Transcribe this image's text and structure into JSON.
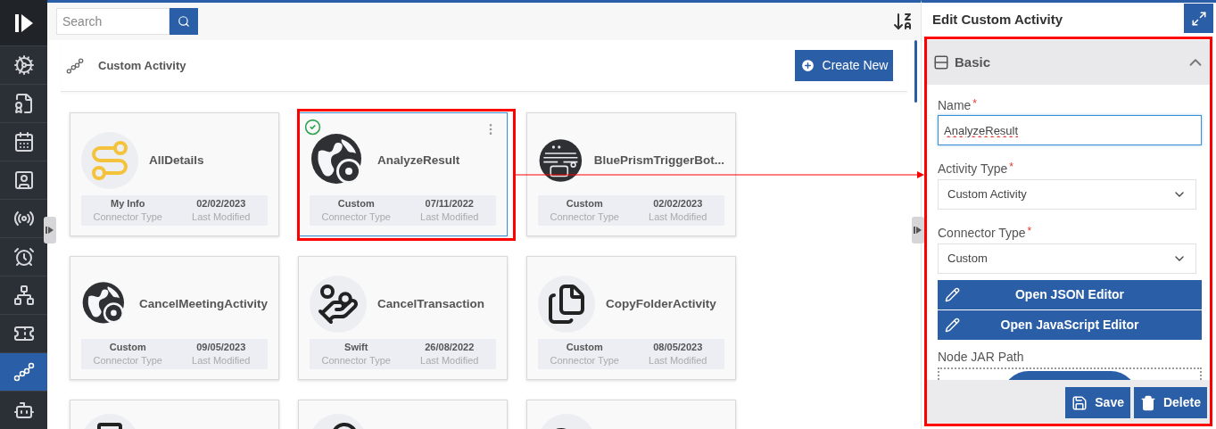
{
  "sidebar": {
    "items": [
      {
        "selected": false
      },
      {
        "selected": false
      },
      {
        "selected": false
      },
      {
        "selected": false
      },
      {
        "selected": false
      },
      {
        "selected": false
      },
      {
        "selected": false
      },
      {
        "selected": false
      },
      {
        "selected": true
      },
      {
        "selected": false
      }
    ]
  },
  "search": {
    "placeholder": "Search"
  },
  "page_title": "Custom Activity",
  "create_button": "Create New",
  "cards": [
    {
      "kind": "full",
      "name": "AllDetails",
      "connector": "My Info",
      "connector_label": "Connector Type",
      "date": "02/02/2023",
      "date_label": "Last Modified",
      "selected": false
    },
    {
      "kind": "full",
      "name": "AnalyzeResult",
      "connector": "Custom",
      "connector_label": "Connector Type",
      "date": "07/11/2022",
      "date_label": "Last Modified",
      "selected": true
    },
    {
      "kind": "full",
      "name": "BluePrismTriggerBot...",
      "connector": "Custom",
      "connector_label": "Connector Type",
      "date": "02/02/2023",
      "date_label": "Last Modified",
      "selected": false
    },
    {
      "kind": "full",
      "name": "CancelMeetingActivity",
      "connector": "Custom",
      "connector_label": "Connector Type",
      "date": "09/05/2023",
      "date_label": "Last Modified",
      "selected": false
    },
    {
      "kind": "full",
      "name": "CancelTransaction",
      "connector": "Swift",
      "connector_label": "Connector Type",
      "date": "26/08/2022",
      "date_label": "Last Modified",
      "selected": false
    },
    {
      "kind": "full",
      "name": "CopyFolderActivity",
      "connector": "Custom",
      "connector_label": "Connector Type",
      "date": "08/05/2023",
      "date_label": "Last Modified",
      "selected": false
    },
    {
      "kind": "cut",
      "selected": false
    },
    {
      "kind": "cut",
      "selected": false
    },
    {
      "kind": "cut",
      "selected": false
    }
  ],
  "editor": {
    "title": "Edit Custom Activity",
    "section": {
      "title": "Basic",
      "expanded": true
    },
    "fields": [
      {
        "kind": "input",
        "label": "Name",
        "required_mark": "*",
        "value": "AnalyzeResult"
      },
      {
        "kind": "select",
        "label": "Activity Type",
        "required_mark": "*",
        "value": "Custom Activity"
      },
      {
        "kind": "select",
        "label": "Connector Type",
        "required_mark": "*",
        "value": "Custom"
      }
    ],
    "editor_buttons": [
      "Open JSON Editor",
      "Open JavaScript Editor"
    ],
    "path_label": "Node JAR Path",
    "actions": [
      {
        "kind": "save",
        "label": "Save"
      },
      {
        "kind": "delete",
        "label": "Delete"
      }
    ]
  }
}
